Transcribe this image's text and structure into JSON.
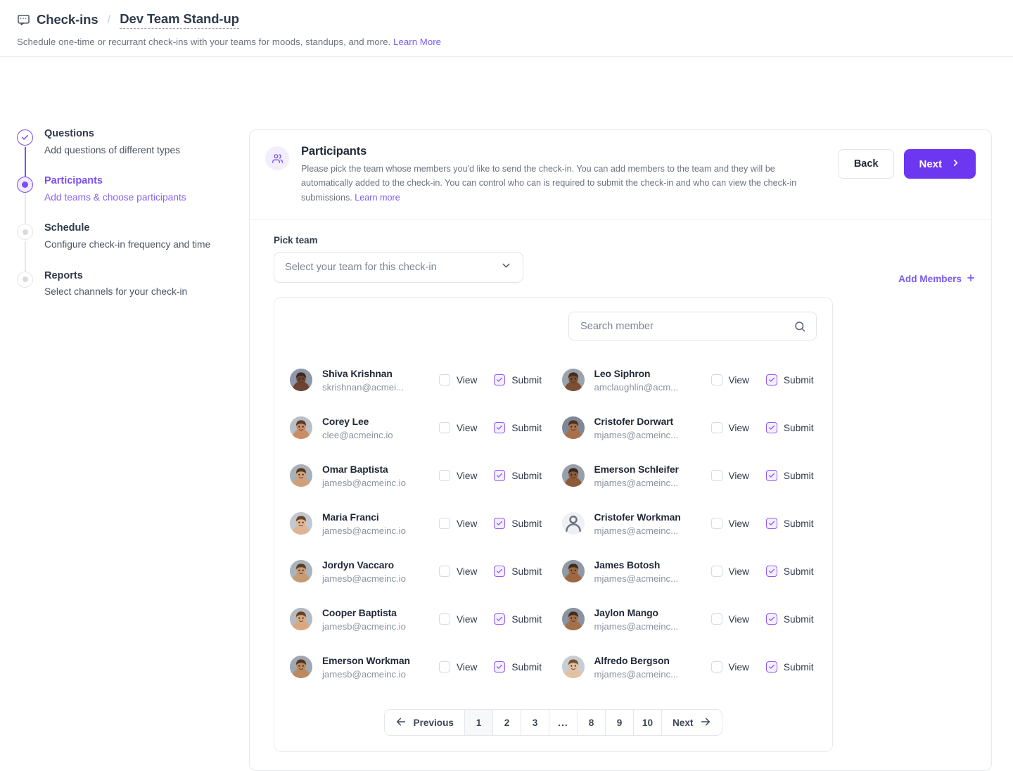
{
  "header": {
    "breadcrumb_icon": "chat-bubble-icon",
    "breadcrumb_root": "Check-ins",
    "breadcrumb_separator": "/",
    "breadcrumb_current": "Dev Team Stand-up",
    "subtitle": "Schedule one-time or recurrant check-ins with your teams for moods, standups, and more.",
    "subtitle_link": "Learn More"
  },
  "stepper": {
    "steps": [
      {
        "title": "Questions",
        "desc": "Add questions of different types",
        "state": "done"
      },
      {
        "title": "Participants",
        "desc": "Add teams & choose participants",
        "state": "active"
      },
      {
        "title": "Schedule",
        "desc": "Configure check-in frequency and time",
        "state": "todo"
      },
      {
        "title": "Reports",
        "desc": "Select channels for your check-in",
        "state": "todo"
      }
    ]
  },
  "card": {
    "icon": "users-icon",
    "title": "Participants",
    "description": "Please pick the team whose members you'd like to send the check-in. You can add members to the team and they will be automatically added to the check-in. You can control who can is required to submit the check-in and who can view the check-in submissions.",
    "description_link": "Learn more",
    "back_label": "Back",
    "next_label": "Next"
  },
  "team": {
    "pick_label": "Pick team",
    "select_placeholder": "Select your team for this check-in",
    "add_members_label": "Add Members"
  },
  "search": {
    "placeholder": "Search member",
    "value": ""
  },
  "permissions": {
    "view_label": "View",
    "submit_label": "Submit"
  },
  "members": [
    {
      "name": "Shiva Krishnan",
      "email": "skrishnan@acmei...",
      "avatar": "photo",
      "view": false,
      "submit": true
    },
    {
      "name": "Leo Siphron",
      "email": "amclaughlin@acm...",
      "avatar": "photo",
      "view": false,
      "submit": true
    },
    {
      "name": "Corey Lee",
      "email": "clee@acmeinc.io",
      "avatar": "photo",
      "view": false,
      "submit": true
    },
    {
      "name": "Cristofer Dorwart",
      "email": "mjames@acmeinc...",
      "avatar": "photo",
      "view": false,
      "submit": true
    },
    {
      "name": "Omar Baptista",
      "email": "jamesb@acmeinc.io",
      "avatar": "photo",
      "view": false,
      "submit": true
    },
    {
      "name": "Emerson Schleifer",
      "email": "mjames@acmeinc...",
      "avatar": "photo",
      "view": false,
      "submit": true
    },
    {
      "name": "Maria Franci",
      "email": "jamesb@acmeinc.io",
      "avatar": "photo",
      "view": false,
      "submit": true
    },
    {
      "name": "Cristofer Workman",
      "email": "mjames@acmeinc...",
      "avatar": "placeholder",
      "view": false,
      "submit": true
    },
    {
      "name": "Jordyn Vaccaro",
      "email": "jamesb@acmeinc.io",
      "avatar": "photo",
      "view": false,
      "submit": true
    },
    {
      "name": "James Botosh",
      "email": "mjames@acmeinc...",
      "avatar": "photo",
      "view": false,
      "submit": true
    },
    {
      "name": "Cooper Baptista",
      "email": "jamesb@acmeinc.io",
      "avatar": "photo",
      "view": false,
      "submit": true
    },
    {
      "name": "Jaylon Mango",
      "email": "mjames@acmeinc...",
      "avatar": "photo",
      "view": false,
      "submit": true
    },
    {
      "name": "Emerson Workman",
      "email": "jamesb@acmeinc.io",
      "avatar": "photo",
      "view": false,
      "submit": true
    },
    {
      "name": "Alfredo Bergson",
      "email": "mjames@acmeinc...",
      "avatar": "photo",
      "view": false,
      "submit": true
    }
  ],
  "pagination": {
    "previous_label": "Previous",
    "next_label": "Next",
    "pages": [
      "1",
      "2",
      "3",
      "...",
      "8",
      "9",
      "10"
    ],
    "current": "1"
  },
  "colors": {
    "accent": "#6d36f0",
    "accent_light": "#7c4ff0",
    "link": "#7a5af5",
    "text": "#1f2937",
    "muted": "#6b7280",
    "border": "#e9eaee"
  }
}
